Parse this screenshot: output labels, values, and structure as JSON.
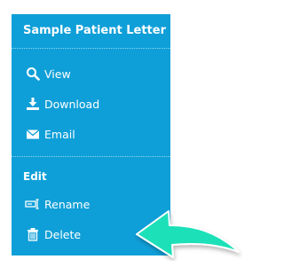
{
  "panel": {
    "title": "Sample Patient Letter",
    "primary_actions": [
      {
        "label": "View",
        "icon": "magnifier-icon"
      },
      {
        "label": "Download",
        "icon": "download-icon"
      },
      {
        "label": "Email",
        "icon": "envelope-icon"
      }
    ],
    "edit_section": {
      "heading": "Edit",
      "items": [
        {
          "label": "Rename",
          "icon": "rename-field-icon"
        },
        {
          "label": "Delete",
          "icon": "trash-icon"
        }
      ]
    }
  },
  "colors": {
    "panel_bg": "#0f9fd8",
    "text": "#ffffff",
    "arrow_fill": "#1fe0b8",
    "arrow_outline": "#ffffff"
  }
}
